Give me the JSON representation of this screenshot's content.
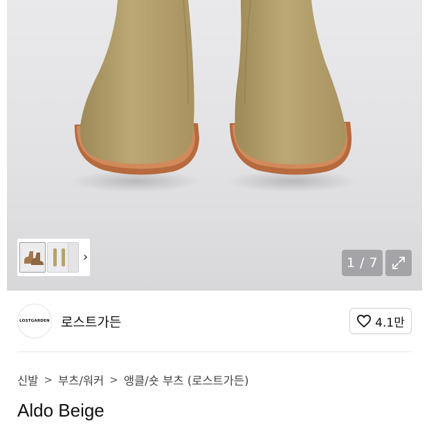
{
  "gallery": {
    "counter": "1 / 7",
    "current_image": 1,
    "total_images": 7,
    "thumbnail_next_icon": "chevron-right-icon",
    "expand_icon": "expand-arrows-icon"
  },
  "brand": {
    "logo_text": "LOSTGARDEN",
    "name": "로스트가든"
  },
  "like": {
    "icon": "heart-outline-icon",
    "count": "4.1만"
  },
  "breadcrumb": [
    {
      "label": "신발"
    },
    {
      "label": "부츠/워커"
    },
    {
      "label": "앵클/숏 부츠 (로스트가든)"
    }
  ],
  "breadcrumb_separator": ">",
  "product": {
    "title": "Aldo Beige"
  },
  "colors": {
    "suede": "#b8a26e",
    "sole": "#c97a4c",
    "gallery_bg": "#e4e4e6",
    "overlay": "#5a5a5f"
  }
}
